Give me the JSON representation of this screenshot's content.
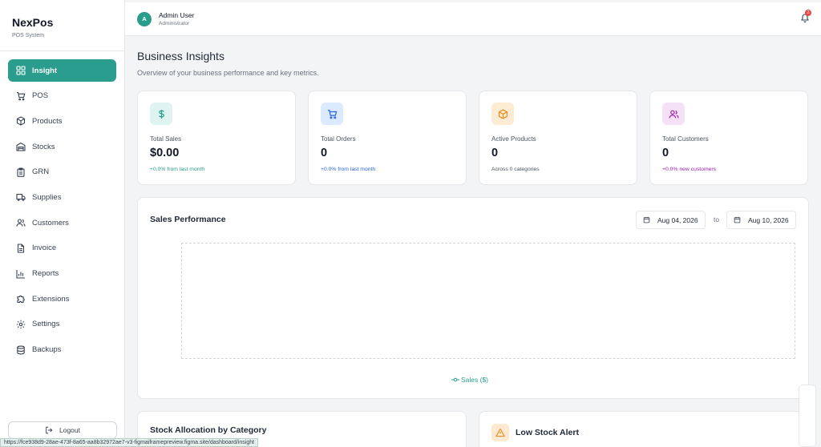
{
  "brand": {
    "name": "NexPos",
    "subtitle": "POS System"
  },
  "sidebar": {
    "items": [
      {
        "label": "Insight",
        "icon": "grid-icon",
        "active": true
      },
      {
        "label": "POS",
        "icon": "cart-icon"
      },
      {
        "label": "Products",
        "icon": "box-icon"
      },
      {
        "label": "Stocks",
        "icon": "warehouse-icon"
      },
      {
        "label": "GRN",
        "icon": "clipboard-icon"
      },
      {
        "label": "Supplies",
        "icon": "truck-icon"
      },
      {
        "label": "Customers",
        "icon": "users-icon"
      },
      {
        "label": "Invoice",
        "icon": "file-icon"
      },
      {
        "label": "Reports",
        "icon": "bar-chart-icon"
      },
      {
        "label": "Extensions",
        "icon": "puzzle-icon"
      },
      {
        "label": "Settings",
        "icon": "gear-icon"
      },
      {
        "label": "Backups",
        "icon": "database-icon"
      }
    ],
    "logout": "Logout"
  },
  "url_tooltip": "https://fce938d9-28ae-473f-8a65-aa8b32972ae7-v3-figmaiframepreview.figma.site/dashboard/insight",
  "header": {
    "avatar_initial": "A",
    "user_name": "Admin User",
    "user_role": "Administrator",
    "notification_count": "2"
  },
  "page": {
    "title": "Business Insights",
    "subtitle": "Overview of your business performance and key metrics."
  },
  "stats": [
    {
      "label": "Total Sales",
      "value": "$0.00",
      "note": "+0.0% from last month",
      "icon": "dollar-icon",
      "color": "#2a9d8f"
    },
    {
      "label": "Total Orders",
      "value": "0",
      "note": "+0.0% from last month",
      "icon": "cart-icon",
      "color": "#2563eb"
    },
    {
      "label": "Active Products",
      "value": "0",
      "note": "Across 0 categories",
      "icon": "box-icon",
      "color": "#ea8a1e"
    },
    {
      "label": "Total Customers",
      "value": "0",
      "note": "+0.0% new customers",
      "icon": "users-icon",
      "color": "#a21caf"
    }
  ],
  "performance": {
    "title": "Sales Performance",
    "date_from": "Aug 04, 2026",
    "to_label": "to",
    "date_to": "Aug 10, 2026",
    "legend": "Sales ($)"
  },
  "stock_allocation": {
    "title": "Stock Allocation by Category"
  },
  "low_stock": {
    "title": "Low Stock Alert"
  },
  "colors": {
    "accent": "#2a9d8f",
    "danger": "#ef4444"
  }
}
